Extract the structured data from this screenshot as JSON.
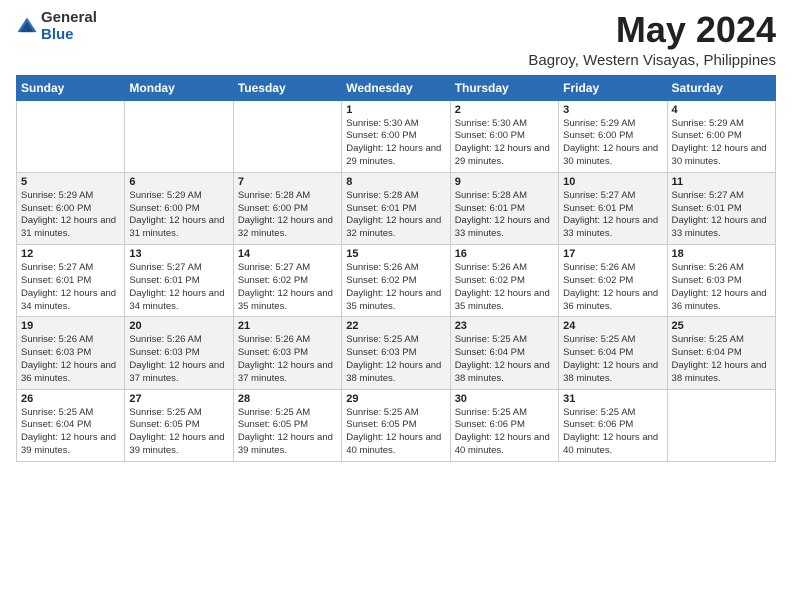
{
  "logo": {
    "general": "General",
    "blue": "Blue"
  },
  "title": "May 2024",
  "location": "Bagroy, Western Visayas, Philippines",
  "weekdays": [
    "Sunday",
    "Monday",
    "Tuesday",
    "Wednesday",
    "Thursday",
    "Friday",
    "Saturday"
  ],
  "weeks": [
    [
      {
        "day": "",
        "detail": ""
      },
      {
        "day": "",
        "detail": ""
      },
      {
        "day": "",
        "detail": ""
      },
      {
        "day": "1",
        "detail": "Sunrise: 5:30 AM\nSunset: 6:00 PM\nDaylight: 12 hours\nand 29 minutes."
      },
      {
        "day": "2",
        "detail": "Sunrise: 5:30 AM\nSunset: 6:00 PM\nDaylight: 12 hours\nand 29 minutes."
      },
      {
        "day": "3",
        "detail": "Sunrise: 5:29 AM\nSunset: 6:00 PM\nDaylight: 12 hours\nand 30 minutes."
      },
      {
        "day": "4",
        "detail": "Sunrise: 5:29 AM\nSunset: 6:00 PM\nDaylight: 12 hours\nand 30 minutes."
      }
    ],
    [
      {
        "day": "5",
        "detail": "Sunrise: 5:29 AM\nSunset: 6:00 PM\nDaylight: 12 hours\nand 31 minutes."
      },
      {
        "day": "6",
        "detail": "Sunrise: 5:29 AM\nSunset: 6:00 PM\nDaylight: 12 hours\nand 31 minutes."
      },
      {
        "day": "7",
        "detail": "Sunrise: 5:28 AM\nSunset: 6:00 PM\nDaylight: 12 hours\nand 32 minutes."
      },
      {
        "day": "8",
        "detail": "Sunrise: 5:28 AM\nSunset: 6:01 PM\nDaylight: 12 hours\nand 32 minutes."
      },
      {
        "day": "9",
        "detail": "Sunrise: 5:28 AM\nSunset: 6:01 PM\nDaylight: 12 hours\nand 33 minutes."
      },
      {
        "day": "10",
        "detail": "Sunrise: 5:27 AM\nSunset: 6:01 PM\nDaylight: 12 hours\nand 33 minutes."
      },
      {
        "day": "11",
        "detail": "Sunrise: 5:27 AM\nSunset: 6:01 PM\nDaylight: 12 hours\nand 33 minutes."
      }
    ],
    [
      {
        "day": "12",
        "detail": "Sunrise: 5:27 AM\nSunset: 6:01 PM\nDaylight: 12 hours\nand 34 minutes."
      },
      {
        "day": "13",
        "detail": "Sunrise: 5:27 AM\nSunset: 6:01 PM\nDaylight: 12 hours\nand 34 minutes."
      },
      {
        "day": "14",
        "detail": "Sunrise: 5:27 AM\nSunset: 6:02 PM\nDaylight: 12 hours\nand 35 minutes."
      },
      {
        "day": "15",
        "detail": "Sunrise: 5:26 AM\nSunset: 6:02 PM\nDaylight: 12 hours\nand 35 minutes."
      },
      {
        "day": "16",
        "detail": "Sunrise: 5:26 AM\nSunset: 6:02 PM\nDaylight: 12 hours\nand 35 minutes."
      },
      {
        "day": "17",
        "detail": "Sunrise: 5:26 AM\nSunset: 6:02 PM\nDaylight: 12 hours\nand 36 minutes."
      },
      {
        "day": "18",
        "detail": "Sunrise: 5:26 AM\nSunset: 6:03 PM\nDaylight: 12 hours\nand 36 minutes."
      }
    ],
    [
      {
        "day": "19",
        "detail": "Sunrise: 5:26 AM\nSunset: 6:03 PM\nDaylight: 12 hours\nand 36 minutes."
      },
      {
        "day": "20",
        "detail": "Sunrise: 5:26 AM\nSunset: 6:03 PM\nDaylight: 12 hours\nand 37 minutes."
      },
      {
        "day": "21",
        "detail": "Sunrise: 5:26 AM\nSunset: 6:03 PM\nDaylight: 12 hours\nand 37 minutes."
      },
      {
        "day": "22",
        "detail": "Sunrise: 5:25 AM\nSunset: 6:03 PM\nDaylight: 12 hours\nand 38 minutes."
      },
      {
        "day": "23",
        "detail": "Sunrise: 5:25 AM\nSunset: 6:04 PM\nDaylight: 12 hours\nand 38 minutes."
      },
      {
        "day": "24",
        "detail": "Sunrise: 5:25 AM\nSunset: 6:04 PM\nDaylight: 12 hours\nand 38 minutes."
      },
      {
        "day": "25",
        "detail": "Sunrise: 5:25 AM\nSunset: 6:04 PM\nDaylight: 12 hours\nand 38 minutes."
      }
    ],
    [
      {
        "day": "26",
        "detail": "Sunrise: 5:25 AM\nSunset: 6:04 PM\nDaylight: 12 hours\nand 39 minutes."
      },
      {
        "day": "27",
        "detail": "Sunrise: 5:25 AM\nSunset: 6:05 PM\nDaylight: 12 hours\nand 39 minutes."
      },
      {
        "day": "28",
        "detail": "Sunrise: 5:25 AM\nSunset: 6:05 PM\nDaylight: 12 hours\nand 39 minutes."
      },
      {
        "day": "29",
        "detail": "Sunrise: 5:25 AM\nSunset: 6:05 PM\nDaylight: 12 hours\nand 40 minutes."
      },
      {
        "day": "30",
        "detail": "Sunrise: 5:25 AM\nSunset: 6:06 PM\nDaylight: 12 hours\nand 40 minutes."
      },
      {
        "day": "31",
        "detail": "Sunrise: 5:25 AM\nSunset: 6:06 PM\nDaylight: 12 hours\nand 40 minutes."
      },
      {
        "day": "",
        "detail": ""
      }
    ]
  ]
}
